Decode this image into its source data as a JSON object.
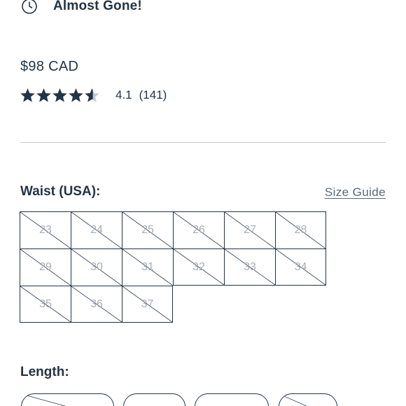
{
  "availability": {
    "icon": "clock-icon",
    "text": "Almost Gone!"
  },
  "price": "$98 CAD",
  "rating": {
    "value_number": 4.1,
    "max": 5,
    "value": "4.1",
    "count": "(141)",
    "star_color": "#243447",
    "empty_star_color": "#c6c9cc"
  },
  "waist": {
    "label": "Waist (USA):",
    "size_guide": "Size Guide",
    "sizes": [
      {
        "label": "23",
        "available": false
      },
      {
        "label": "24",
        "available": false
      },
      {
        "label": "25",
        "available": false
      },
      {
        "label": "26",
        "available": false
      },
      {
        "label": "27",
        "available": false
      },
      {
        "label": "28",
        "available": false
      },
      {
        "label": "29",
        "available": false
      },
      {
        "label": "30",
        "available": false
      },
      {
        "label": "31",
        "available": false
      },
      {
        "label": "32",
        "available": false
      },
      {
        "label": "33",
        "available": false
      },
      {
        "label": "34",
        "available": false
      },
      {
        "label": "35",
        "available": false
      },
      {
        "label": "36",
        "available": false
      },
      {
        "label": "37",
        "available": false
      }
    ]
  },
  "length": {
    "label": "Length:",
    "options": [
      {
        "available": false
      },
      {
        "available": true
      },
      {
        "available": true
      },
      {
        "available": false
      }
    ]
  },
  "colors": {
    "text": "#243447",
    "muted": "#a7adb3",
    "divider": "#c8c8c8"
  }
}
